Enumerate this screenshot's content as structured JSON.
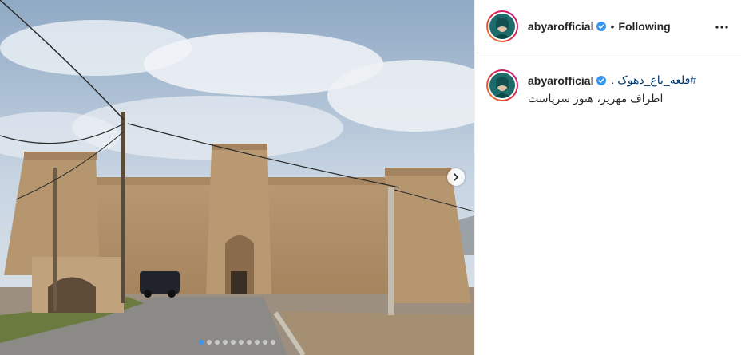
{
  "post": {
    "photo_icon": "photo-castle",
    "slide_count": 10,
    "active_slide": 0
  },
  "header": {
    "username": "abyarofficial",
    "verified_icon": "verified-badge-icon",
    "separator": "•",
    "follow_status": "Following",
    "more_icon": "more-options-icon"
  },
  "caption": {
    "username": "abyarofficial",
    "hashtag": "#قلعه_باغ_دهوک .",
    "text": "اطراف مهریز، هنوز سرپاست"
  },
  "colors": {
    "accent": "#3897f0",
    "hashtag": "#00376b",
    "verified": "#3897f0"
  }
}
